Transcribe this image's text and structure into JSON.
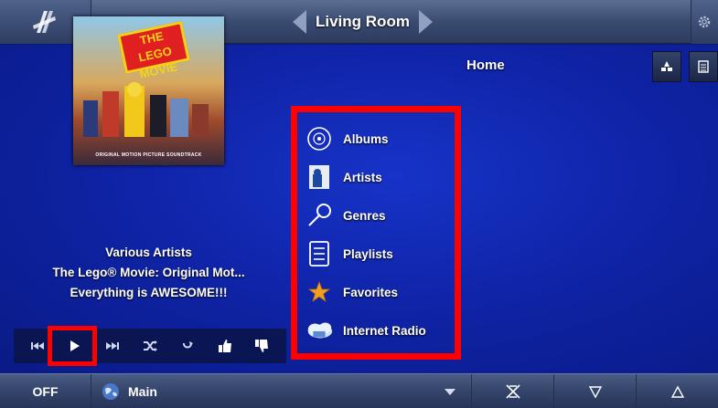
{
  "header": {
    "room_title": "Living Room"
  },
  "now_playing": {
    "album_art_caption": "ORIGINAL MOTION PICTURE SOUNDTRACK",
    "album_art_logo": "THE LEGO MOVIE",
    "artist": "Various Artists",
    "album": "The Lego® Movie: Original Mot...",
    "song": "Everything is AWESOME!!!"
  },
  "transport": {
    "buttons": [
      "previous",
      "play",
      "next",
      "shuffle",
      "repeat",
      "thumbs-up",
      "thumbs-down"
    ]
  },
  "browse": {
    "title": "Home",
    "items": [
      {
        "label": "Albums",
        "icon": "album-disc-icon"
      },
      {
        "label": "Artists",
        "icon": "artist-icon"
      },
      {
        "label": "Genres",
        "icon": "genre-guitar-icon"
      },
      {
        "label": "Playlists",
        "icon": "playlist-icon"
      },
      {
        "label": "Favorites",
        "icon": "star-icon"
      },
      {
        "label": "Internet Radio",
        "icon": "cloud-radio-icon"
      }
    ]
  },
  "footer": {
    "off_label": "OFF",
    "zone_label": "Main"
  },
  "colors": {
    "highlight": "#ff0000",
    "background": "#0f24a8",
    "star": "#f0a020"
  }
}
